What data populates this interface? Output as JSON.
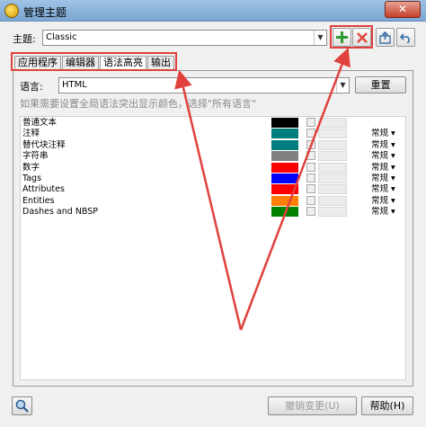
{
  "window": {
    "title": "管理主题",
    "close_label": "✕"
  },
  "theme": {
    "label": "主题:",
    "value": "Classic"
  },
  "toolbar": {
    "add_icon": "plus-icon",
    "delete_icon": "x-icon",
    "export_icon": "export-icon",
    "undo_icon": "undo-icon"
  },
  "tabs": [
    {
      "label": "应用程序",
      "active": false
    },
    {
      "label": "编辑器",
      "active": false
    },
    {
      "label": "语法高亮",
      "active": true
    },
    {
      "label": "输出",
      "active": false
    }
  ],
  "language": {
    "label": "语言:",
    "value": "HTML",
    "reset_label": "重置"
  },
  "hint": "如果需要设置全局语法突出显示颜色，选择\"所有语言\"",
  "styles": [
    {
      "name": "普通文本",
      "color": "#000000",
      "font_style": ""
    },
    {
      "name": "注释",
      "color": "#007d7d",
      "font_style": "常规 ▾"
    },
    {
      "name": "替代块注释",
      "color": "#007d7d",
      "font_style": "常规 ▾"
    },
    {
      "name": "字符串",
      "color": "#808080",
      "font_style": "常规 ▾"
    },
    {
      "name": "数字",
      "color": "#ff0000",
      "font_style": "常规 ▾"
    },
    {
      "name": "Tags",
      "color": "#0000ff",
      "font_style": "常规 ▾"
    },
    {
      "name": "Attributes",
      "color": "#ff0000",
      "font_style": "常规 ▾"
    },
    {
      "name": "Entities",
      "color": "#ff8000",
      "font_style": "常规 ▾"
    },
    {
      "name": "Dashes and NBSP",
      "color": "#008000",
      "font_style": "常规 ▾"
    }
  ],
  "footer": {
    "cancel_label": "撤销变更(U)",
    "help_label": "帮助(H)"
  },
  "colors": {
    "annotation": "#e0413c",
    "titlebar": "#7aa6d2"
  }
}
